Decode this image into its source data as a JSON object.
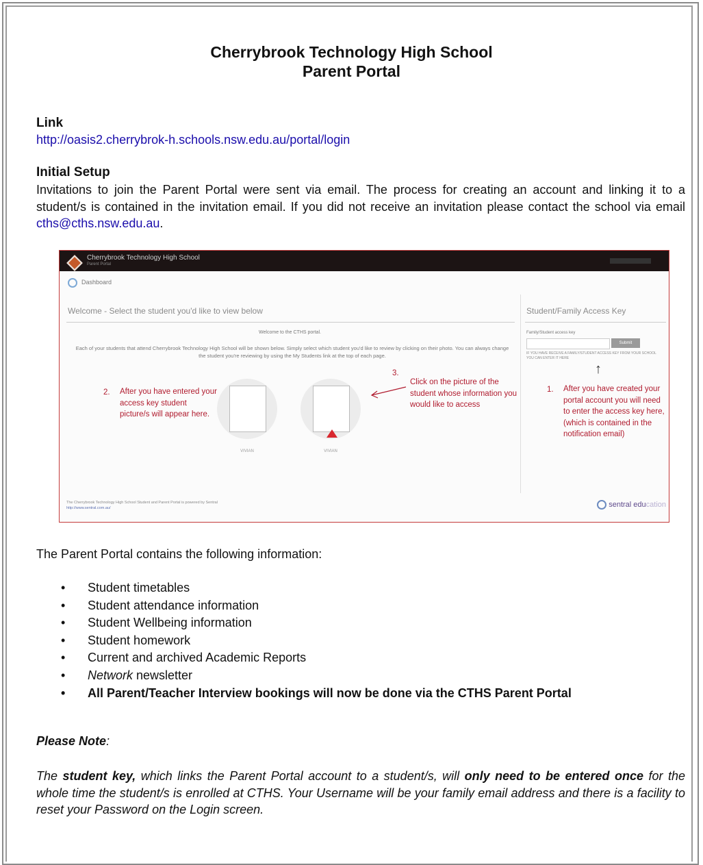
{
  "header": {
    "school_name": "Cherrybrook Technology High School",
    "portal_title": "Parent Portal"
  },
  "link_section": {
    "heading": "Link",
    "url": "http://oasis2.cherrybrok-h.schools.nsw.edu.au/portal/login"
  },
  "setup_section": {
    "heading": "Initial Setup",
    "text": "Invitations to join the Parent Portal were sent via email. The process for creating an account and linking it to a student/s is contained in the invitation email. If you did not receive an invitation please contact the school via email",
    "email": "cths@cths.nsw.edu.au",
    "trailing": "."
  },
  "portal_screenshot": {
    "bar_title": "Cherrybrook Technology High School",
    "bar_subtitle": "Parent Portal",
    "dashboard_label": "Dashboard",
    "welcome_heading": "Welcome - Select the student you'd like to view below",
    "key_heading": "Student/Family Access Key",
    "welcome_small": "Welcome to the CTHS portal.",
    "intro": "Each of your students that attend Cherrybrook Technology High School will be shown below. Simply select which student you'd like to review by clicking on their photo. You can always change the student you're reviewing by using the My Students link at the top of each page.",
    "family_key_label": "Family/Student access key",
    "submit_label": "Submit",
    "family_key_note": "IF YOU HAVE RECEIVE A FAMILY/STUDENT ACCESS KEY FROM YOUR SCHOOL YOU CAN ENTER IT HERE",
    "student_labels": [
      "VIVIAN",
      "VIVIAN"
    ],
    "annotation_1_num": "1.",
    "annotation_1": "After you have created your portal account you will need to enter the access key here, (which is contained in the notification email)",
    "annotation_2_num": "2.",
    "annotation_2": "After you have entered your access key student picture/s will appear here.",
    "annotation_3_num": "3.",
    "annotation_3": "Click on the picture of the student whose information you would like to access",
    "footer_text": "The Cherrybrook Technology High School Student and Parent Portal is powered by Sentral",
    "footer_link": "http://www.sentral.com.au/",
    "vendor_brand": "sentral edu",
    "vendor_brand_faint": "cation"
  },
  "contents": {
    "intro": "The Parent Portal contains the following information:",
    "items": [
      {
        "pre": "Student timetables",
        "italic": "",
        "post": ""
      },
      {
        "pre": "Student attendance information",
        "italic": "",
        "post": ""
      },
      {
        "pre": "Student Wellbeing information",
        "italic": "",
        "post": ""
      },
      {
        "pre": "Student homework",
        "italic": "",
        "post": ""
      },
      {
        "pre": "Current and archived Academic Reports",
        "italic": "",
        "post": ""
      },
      {
        "pre": "",
        "italic": "Network",
        "post": " newsletter"
      },
      {
        "pre": "All Parent/Teacher Interview bookings will now be done via the CTHS Parent Portal",
        "italic": "",
        "post": ""
      }
    ],
    "bullet": "•"
  },
  "note": {
    "heading": "Please Note",
    "heading_colon": ":",
    "p1": "The ",
    "b1": "student key,",
    "p2": " which links the Parent Portal account to a student/s, will ",
    "b2": "only need to be entered once",
    "p3": " for the whole time the student/s is enrolled at CTHS. Your Username will be your family email address and there is a facility to reset your Password on the Login screen."
  }
}
